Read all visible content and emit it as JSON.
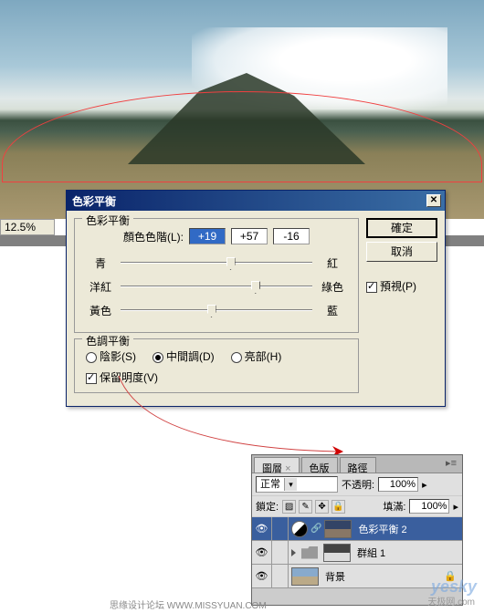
{
  "zoom": "12.5%",
  "dialog": {
    "title": "色彩平衡",
    "group1_title": "色彩平衡",
    "levels_label": "顏色色階(L):",
    "levels": {
      "cyan_red": "+19",
      "magenta_green": "+57",
      "yellow_blue": "-16"
    },
    "sliders": [
      {
        "left": "青",
        "right": "紅",
        "pos": 55
      },
      {
        "left": "洋紅",
        "right": "綠色",
        "pos": 68
      },
      {
        "left": "黃色",
        "right": "藍",
        "pos": 45
      }
    ],
    "group2_title": "色調平衡",
    "tones": {
      "shadows": "陰影(S)",
      "midtones": "中間調(D)",
      "highlights": "亮部(H)"
    },
    "preserve_lum": "保留明度(V)",
    "ok": "確定",
    "cancel": "取消",
    "preview": "預視(P)"
  },
  "layers": {
    "tabs": {
      "layers": "圖層",
      "channels": "色版",
      "paths": "路徑"
    },
    "blend_mode": "正常",
    "opacity_label": "不透明:",
    "opacity": "100%",
    "lock_label": "鎖定:",
    "fill_label": "填滿:",
    "fill": "100%",
    "items": [
      {
        "name": "色彩平衡 2",
        "type": "adjustment",
        "selected": true
      },
      {
        "name": "群組 1",
        "type": "group"
      },
      {
        "name": "背景",
        "type": "bg"
      }
    ]
  },
  "watermark": "yesky",
  "watermark_sub": "天极网.com",
  "footer": "思缘设计论坛  WWW.MISSYUAN.COM"
}
